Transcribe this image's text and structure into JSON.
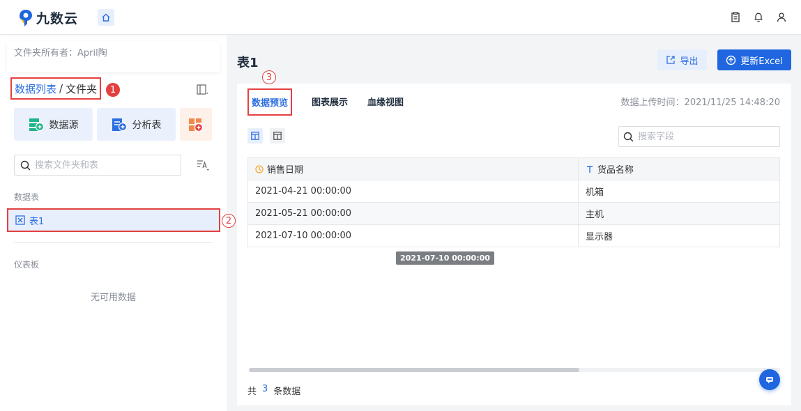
{
  "app": {
    "logo_text": "九数云"
  },
  "sidebar": {
    "owner_label": "文件夹所有者：April陶",
    "breadcrumb": {
      "root": "数据列表",
      "sep": "/",
      "current": "文件夹"
    },
    "create_buttons": [
      {
        "label": "数据源"
      },
      {
        "label": "分析表"
      }
    ],
    "search_placeholder": "搜索文件夹和表",
    "section_tables": "数据表",
    "table_item": "表1",
    "section_dashboards": "仪表板",
    "empty_text": "无可用数据"
  },
  "annotations": {
    "n1": "1",
    "n2": "2",
    "n3": "3"
  },
  "main": {
    "title": "表1",
    "export_label": "导出",
    "update_label": "更新Excel",
    "tabs": [
      {
        "label": "数据预览"
      },
      {
        "label": "图表展示"
      },
      {
        "label": "血缘视图"
      }
    ],
    "upload_time": "数据上传时间：2021/11/25 14:48:20",
    "field_search_placeholder": "搜索字段",
    "table": {
      "columns": [
        "销售日期",
        "货品名称"
      ],
      "rows": [
        [
          "2021-04-21 00:00:00",
          "机箱"
        ],
        [
          "2021-05-21 00:00:00",
          "主机"
        ],
        [
          "2021-07-10 00:00:00",
          "显示器"
        ]
      ]
    },
    "tooltip": "2021-07-10 00:00:00",
    "footer": {
      "prefix": "共",
      "count": "3",
      "suffix": "条数据"
    }
  },
  "colors": {
    "accent": "#1f66e0",
    "annotation": "#e2413f"
  }
}
